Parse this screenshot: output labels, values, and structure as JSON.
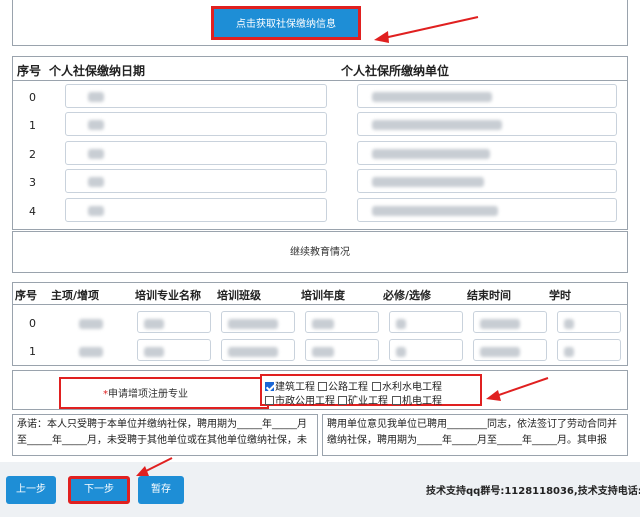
{
  "social_security": {
    "fetch_button": "点击获取社保缴纳信息",
    "columns": [
      "序号",
      "个人社保缴纳日期",
      "个人社保所缴纳单位"
    ],
    "rows": [
      "0",
      "1",
      "2",
      "3",
      "4"
    ]
  },
  "continuing_education": {
    "title": "继续教育情况",
    "columns": [
      "序号",
      "主项/增项",
      "培训专业名称",
      "培训班级",
      "培训年度",
      "必修/选修",
      "结束时间",
      "学时"
    ],
    "rows": [
      "0",
      "1"
    ]
  },
  "major": {
    "required_mark": "*",
    "label": "申请增项注册专业",
    "options": [
      {
        "label": "建筑工程",
        "checked": true
      },
      {
        "label": "公路工程",
        "checked": false
      },
      {
        "label": "水利水电工程",
        "checked": false
      },
      {
        "label": "市政公用工程",
        "checked": false
      },
      {
        "label": "矿业工程",
        "checked": false
      },
      {
        "label": "机电工程",
        "checked": false
      }
    ]
  },
  "promise": {
    "left": "承诺：本人只受聘于本单位并缴纳社保，聘用期为_____年_____月至_____年_____月，未受聘于其他单位或在其他单位缴纳社保，未",
    "right": "聘用单位意见我单位已聘用________同志，依法签订了劳动合同并缴纳社保，聘用期为_____年_____月至_____年_____月。其申报"
  },
  "footer": {
    "prev": "上一步",
    "next": "下一步",
    "save": "暂存",
    "support": "技术支持qq群号:1128118036,技术支持电话:0"
  },
  "colors": {
    "accent": "#1e8ed6",
    "highlight": "#e02020"
  }
}
